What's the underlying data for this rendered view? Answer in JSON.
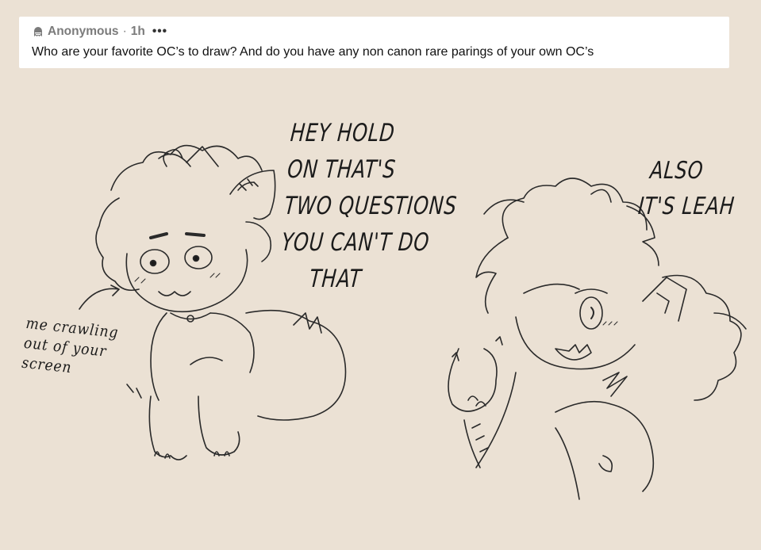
{
  "ask": {
    "author": "Anonymous",
    "separator": "·",
    "time": "1h",
    "more": "•••",
    "question": "Who are your favorite OC’s to draw? And do you have any non canon rare parings of your own OC’s"
  },
  "speech_left": {
    "lines": [
      "HEY HOLD",
      "ON THAT'S",
      "TWO QUESTIONS",
      "YOU CAN'T DO",
      "THAT"
    ]
  },
  "speech_right": {
    "lines": [
      "ALSO",
      "IT'S LEAH"
    ]
  },
  "note": {
    "lines": [
      "me crawling",
      "out of your",
      "screen"
    ]
  },
  "colors": {
    "background": "#ebe1d4",
    "card": "#ffffff",
    "ink": "#1b1b1b",
    "muted": "#7b7b7b"
  },
  "icons": {
    "anonymous": "ghost-icon",
    "more": "ellipsis-icon"
  }
}
